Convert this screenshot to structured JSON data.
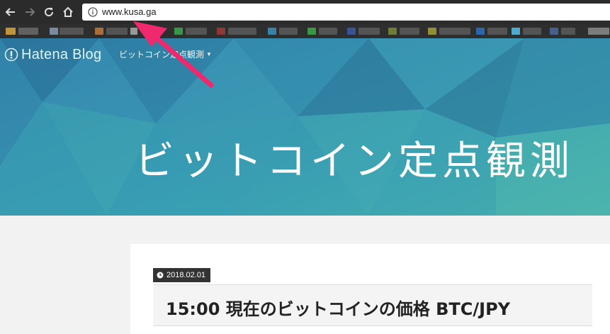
{
  "browser": {
    "url": "www.kusa.ga",
    "icons": [
      "back-icon",
      "forward-icon",
      "reload-icon",
      "home-icon",
      "info-icon"
    ]
  },
  "bookmarks_bar": {
    "note_colors": [
      "#d9a63a",
      "#8a9ab5",
      "#4b6aa0",
      "#c07a3a",
      "#5a5a5a",
      "#3aa84a",
      "#a03a3a",
      "#3a5aa8",
      "#2a6ec0",
      "#7a8a3a",
      "#3a90c0",
      "#55c0e8"
    ]
  },
  "blog": {
    "logo_text": "Hatena Blog",
    "menu_label": "ビットコイン定点観測",
    "title": "ビットコイン定点観測",
    "header_colors": [
      "#2f7fa6",
      "#3ba3b2",
      "#4ab3ad"
    ]
  },
  "entry": {
    "date": "2018.02.01",
    "title": "15:00 現在のビットコインの価格 BTC/JPY"
  },
  "annotation": {
    "arrow_color": "#f0286e"
  }
}
